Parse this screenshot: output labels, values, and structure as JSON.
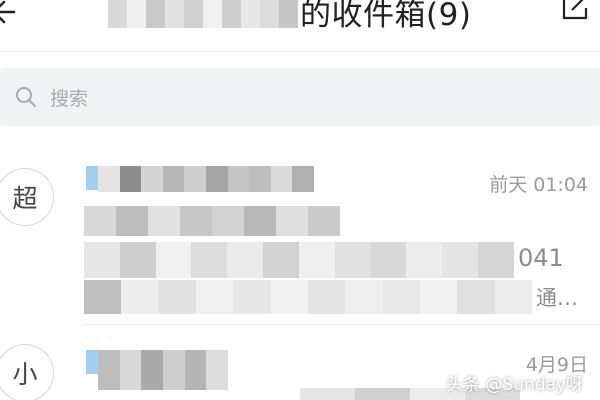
{
  "header": {
    "title_suffix": "的收件箱(9)",
    "back_icon": "back-arrow-icon",
    "compose_icon": "compose-icon"
  },
  "search": {
    "placeholder": "搜索",
    "icon": "search-icon"
  },
  "messages": [
    {
      "avatar_char": "超",
      "time": "前天 01:04",
      "preview_fragment_1": "041",
      "preview_fragment_2": "通…"
    },
    {
      "avatar_char": "小",
      "time": "4月9日"
    }
  ],
  "watermark": "头条 @Sunday呀",
  "colors": {
    "accent_unread": "#9fd0f2",
    "divider": "#e8e8e8",
    "search_bg": "#f1f2f4",
    "muted_text": "#9b9b9b"
  }
}
